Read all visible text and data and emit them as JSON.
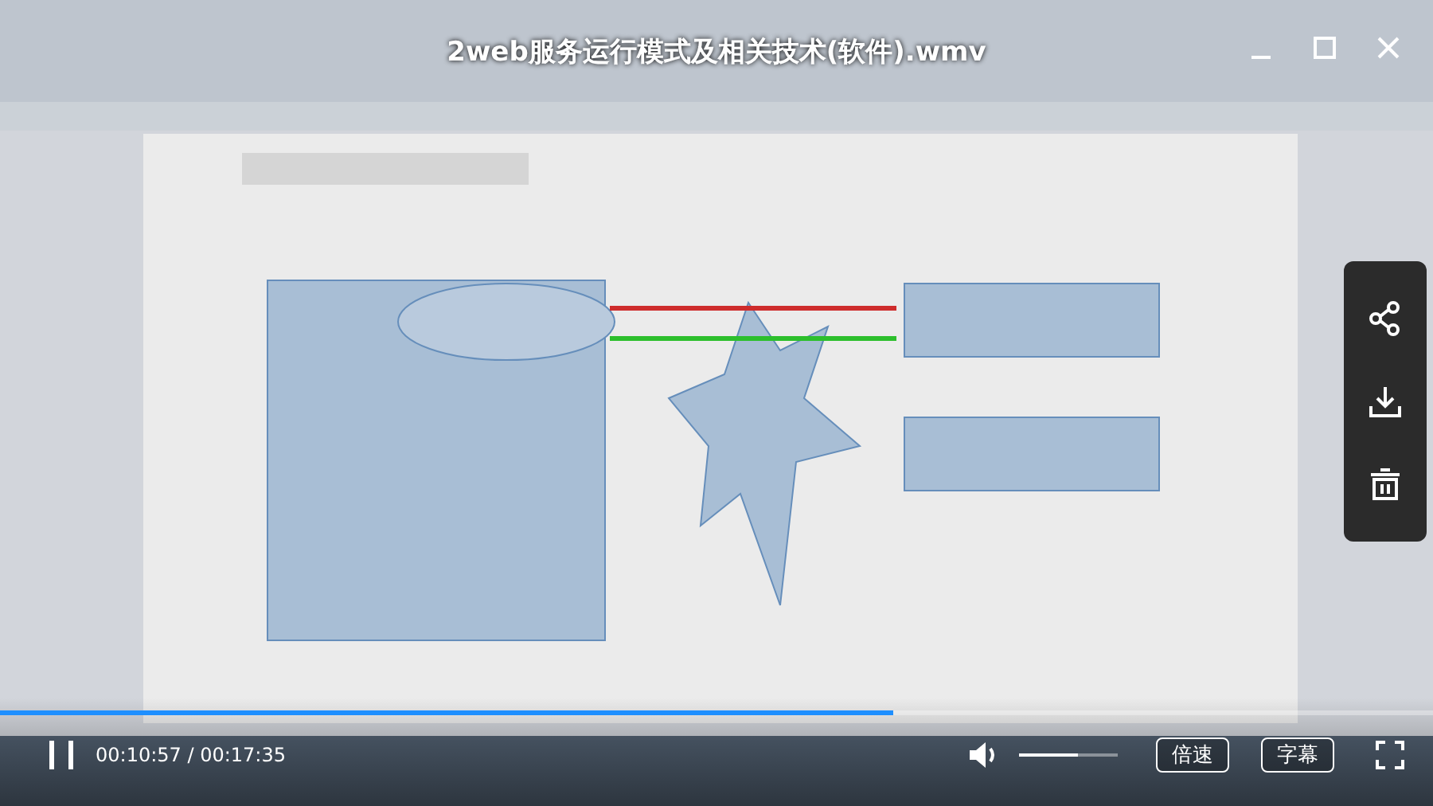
{
  "title": "2web服务运行模式及相关技术(软件).wmv",
  "side_actions": [
    {
      "kind": "share"
    },
    {
      "kind": "download"
    },
    {
      "kind": "delete"
    }
  ],
  "progress": {
    "level": 0.623
  },
  "player": {
    "playing": true,
    "time": "00:10:57 / 00:17:35",
    "volume": {
      "level": 0.6
    },
    "buttons": [
      "倍速",
      "字幕"
    ]
  }
}
